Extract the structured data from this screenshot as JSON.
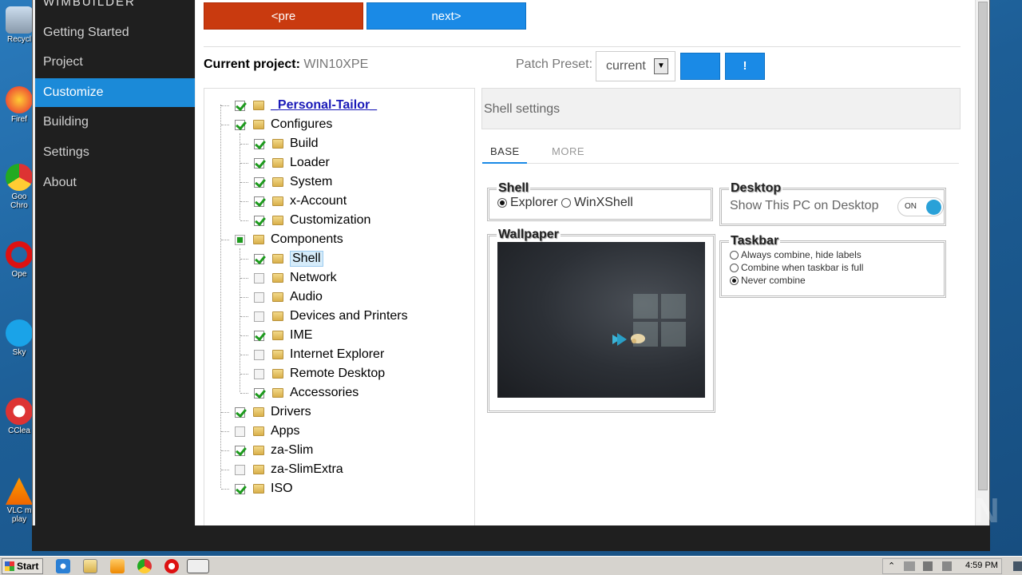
{
  "desktop": {
    "icons": [
      {
        "name": "recycle-bin-icon",
        "label": "Recycl"
      },
      {
        "name": "firefox-icon",
        "label": "Firef"
      },
      {
        "name": "chrome-icon",
        "label": "Goo Chro"
      },
      {
        "name": "opera-icon",
        "label": "Ope"
      },
      {
        "name": "skype-icon",
        "label": "Sky"
      },
      {
        "name": "ccleaner-icon",
        "label": "CClea"
      },
      {
        "name": "vlc-icon",
        "label": "VLC m play"
      }
    ]
  },
  "sidebar": {
    "brand": "WIMBUILDER",
    "items": [
      {
        "label": "Getting Started"
      },
      {
        "label": "Project"
      },
      {
        "label": "Customize",
        "active": true
      },
      {
        "label": "Building"
      },
      {
        "label": "Settings"
      },
      {
        "label": "About"
      }
    ]
  },
  "toolbar": {
    "pre_label": "<pre",
    "next_label": "next>",
    "pre_color": "#c93a0f",
    "next_color": "#1a8ae6"
  },
  "project": {
    "label": "Current project:",
    "value": "WIN10XPE",
    "preset_label": "Patch Preset:",
    "preset_value": "current",
    "button2_label": "!"
  },
  "tree": {
    "items": [
      {
        "label": "_Personal-Tailor_",
        "level": 0,
        "state": "on",
        "special": true
      },
      {
        "label": "Configures",
        "level": 0,
        "state": "on"
      },
      {
        "label": "Build",
        "level": 1,
        "state": "on"
      },
      {
        "label": "Loader",
        "level": 1,
        "state": "on"
      },
      {
        "label": "System",
        "level": 1,
        "state": "on"
      },
      {
        "label": "x-Account",
        "level": 1,
        "state": "on"
      },
      {
        "label": "Customization",
        "level": 1,
        "state": "on"
      },
      {
        "label": "Components",
        "level": 0,
        "state": "partial"
      },
      {
        "label": "Shell",
        "level": 1,
        "state": "on",
        "selected": true
      },
      {
        "label": "Network",
        "level": 1,
        "state": "off"
      },
      {
        "label": "Audio",
        "level": 1,
        "state": "off"
      },
      {
        "label": "Devices and Printers",
        "level": 1,
        "state": "off"
      },
      {
        "label": "IME",
        "level": 1,
        "state": "on"
      },
      {
        "label": "Internet Explorer",
        "level": 1,
        "state": "off"
      },
      {
        "label": "Remote Desktop",
        "level": 1,
        "state": "off"
      },
      {
        "label": "Accessories",
        "level": 1,
        "state": "on"
      },
      {
        "label": "Drivers",
        "level": 0,
        "state": "on"
      },
      {
        "label": "Apps",
        "level": 0,
        "state": "off"
      },
      {
        "label": "za-Slim",
        "level": 0,
        "state": "on"
      },
      {
        "label": "za-SlimExtra",
        "level": 0,
        "state": "off"
      },
      {
        "label": "ISO",
        "level": 0,
        "state": "on"
      }
    ]
  },
  "settings": {
    "title": "Shell settings",
    "tabs": [
      "BASE",
      "MORE"
    ],
    "shell": {
      "legend": "Shell",
      "options": [
        "Explorer",
        "WinXShell"
      ],
      "selected": "Explorer"
    },
    "desktop": {
      "legend": "Desktop",
      "label": "Show This PC on Desktop",
      "toggle_text": "ON"
    },
    "wallpaper": {
      "legend": "Wallpaper"
    },
    "taskbar": {
      "legend": "Taskbar",
      "options": [
        "Always combine, hide labels",
        "Combine when taskbar is full",
        "Never combine"
      ],
      "selected": "Never combine"
    }
  },
  "watermark": "ANY RUN",
  "taskbar": {
    "start_label": "Start",
    "clock": "4:59 PM"
  }
}
